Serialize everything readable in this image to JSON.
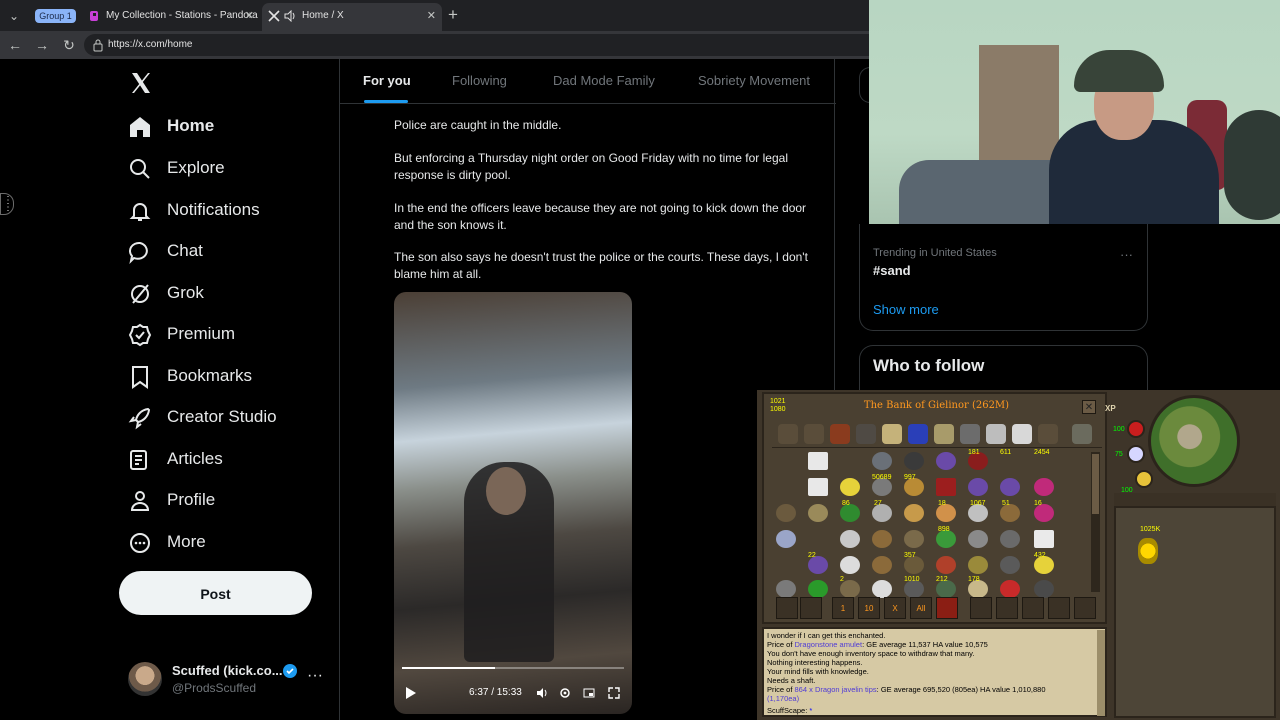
{
  "browser": {
    "tab_group": "Group 1",
    "tabs": [
      {
        "title": "My Collection - Stations - Pandora",
        "close": "✕"
      },
      {
        "title": "Home / X",
        "close": "✕"
      }
    ],
    "new_tab": "+",
    "url": "https://x.com/home"
  },
  "x": {
    "nav": [
      {
        "label": "Home",
        "icon": "home-icon"
      },
      {
        "label": "Explore",
        "icon": "search-icon"
      },
      {
        "label": "Notifications",
        "icon": "bell-icon"
      },
      {
        "label": "Chat",
        "icon": "chat-bubble-icon"
      },
      {
        "label": "Grok",
        "icon": "grok-icon"
      },
      {
        "label": "Premium",
        "icon": "premium-icon"
      },
      {
        "label": "Bookmarks",
        "icon": "bookmark-icon"
      },
      {
        "label": "Creator Studio",
        "icon": "rocket-icon"
      },
      {
        "label": "Articles",
        "icon": "articles-icon"
      },
      {
        "label": "Profile",
        "icon": "person-icon"
      },
      {
        "label": "More",
        "icon": "more-circle-icon"
      }
    ],
    "post_label": "Post",
    "account": {
      "name": "Scuffed (kick.co...",
      "handle": "@ProdsScuffed",
      "more": "···"
    },
    "feed_tabs": [
      "For you",
      "Following",
      "Dad Mode Family",
      "Sobriety Movement"
    ],
    "tweet": {
      "paragraphs": [
        "Police are caught in the middle.",
        "But enforcing a Thursday night order on Good Friday with no time for legal response is dirty pool.",
        "In the end the officers leave because they are not going to kick down the door and the son knows it.",
        "The son also says he doesn't trust the police or the courts. These days, I don't blame him at all."
      ],
      "video": {
        "time": "6:37 / 15:33",
        "progress": 0.42
      }
    },
    "trending": {
      "meta": "Trending in United States",
      "name": "#sand",
      "more": "···",
      "show_more": "Show more"
    },
    "who_to_follow": "Who to follow"
  },
  "game": {
    "bank_title": "The Bank of Gielinor (262M)",
    "bank_capacity": [
      "1021",
      "1080"
    ],
    "close": "✕",
    "xp_label": "XP",
    "quantities": [
      "181",
      "611",
      "2454",
      "50689",
      "997",
      "1067",
      "51",
      "16",
      "86",
      "18",
      "27",
      "898",
      "357",
      "432",
      "212",
      "178",
      "1010",
      "22",
      "2",
      "5",
      "10",
      "X",
      "All"
    ],
    "coins_qty": "1025K",
    "chat_lines": [
      {
        "pre": "I wonder if I can get this enchanted.",
        "hl": "",
        "post": ""
      },
      {
        "pre": "Price of ",
        "hl": "Dragonstone amulet",
        "post": ": GE average 11,537 HA value 10,575"
      },
      {
        "pre": "You don't have enough inventory space to withdraw that many.",
        "hl": "",
        "post": ""
      },
      {
        "pre": "Nothing interesting happens.",
        "hl": "",
        "post": ""
      },
      {
        "pre": "Your mind fills with knowledge.",
        "hl": "",
        "post": ""
      },
      {
        "pre": "Needs a shaft.",
        "hl": "",
        "post": ""
      },
      {
        "pre": "Price of ",
        "hl": "864 x Dragon javelin tips",
        "post": ": GE average 695,520 (805ea) HA value 1,010,880"
      },
      {
        "pre": "(1,170ea)",
        "hl": "",
        "post": ""
      }
    ],
    "chat_input": "ScuffScape:",
    "orbs": [
      "100",
      "75",
      "100"
    ]
  }
}
